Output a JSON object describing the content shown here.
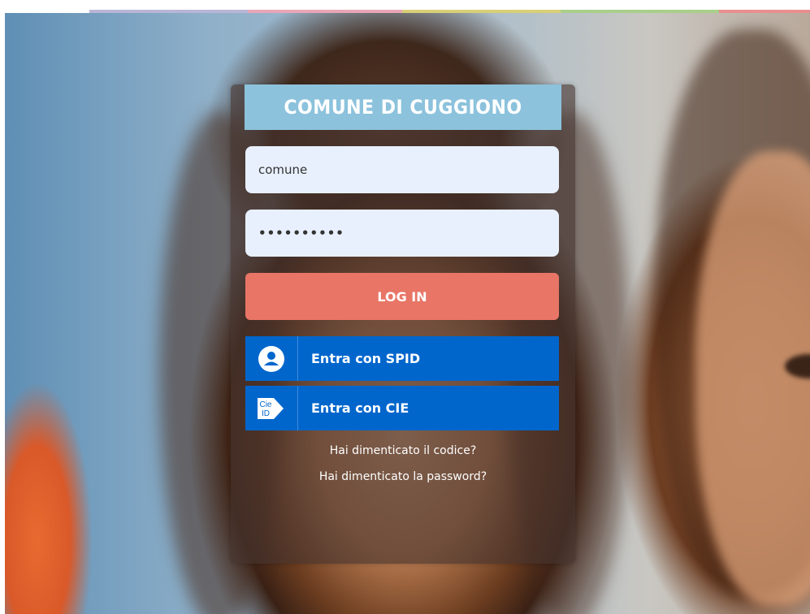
{
  "header": {
    "title": "COMUNE DI CUGGIONO"
  },
  "form": {
    "username_value": "comune",
    "password_value": "••••••••••",
    "login_label": "LOG IN"
  },
  "auth": {
    "spid_label": "Entra con SPID",
    "cie_label": "Entra con CIE",
    "cie_icon_text": "Cie ID"
  },
  "links": {
    "forgot_code": "Hai dimenticato il codice?",
    "forgot_password": "Hai dimenticato la password?"
  },
  "colors": {
    "header": "#8cc2dc",
    "login_button": "#e87566",
    "auth_button": "#0066cc",
    "input_bg": "#e8f0fe",
    "stripe": [
      "#ffffff",
      "#b9b5d6",
      "#e9a6b7",
      "#d9cf77",
      "#a9cf8a",
      "#e98f8f"
    ]
  }
}
